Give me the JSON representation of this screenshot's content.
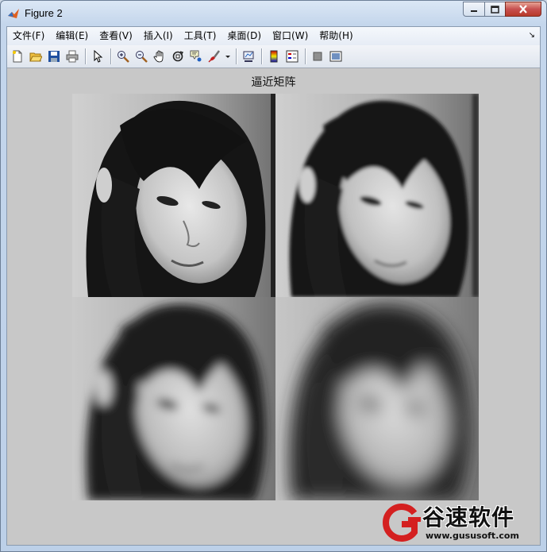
{
  "window": {
    "title": "Figure 2",
    "colors": {
      "close": "#c75050",
      "client": "#c8c8c8"
    }
  },
  "menu": {
    "items": [
      "文件(F)",
      "编辑(E)",
      "查看(V)",
      "插入(I)",
      "工具(T)",
      "桌面(D)",
      "窗口(W)",
      "帮助(H)"
    ]
  },
  "toolbar": {
    "icons": [
      "new-figure-icon",
      "open-file-icon",
      "save-icon",
      "print-icon",
      "pointer-icon",
      "zoom-in-icon",
      "zoom-out-icon",
      "pan-icon",
      "rotate-3d-icon",
      "data-cursor-icon",
      "brush-icon",
      "link-plot-icon",
      "colorbar-icon",
      "legend-icon",
      "hide-plot-tools-icon",
      "show-plot-tools-icon"
    ]
  },
  "figure": {
    "axes_title": "逼近矩阵",
    "images": [
      "original-image",
      "approximation-level-1",
      "approximation-level-2",
      "approximation-level-3"
    ]
  },
  "watermark": {
    "title": "谷速软件",
    "url": "www.gususoft.com"
  }
}
